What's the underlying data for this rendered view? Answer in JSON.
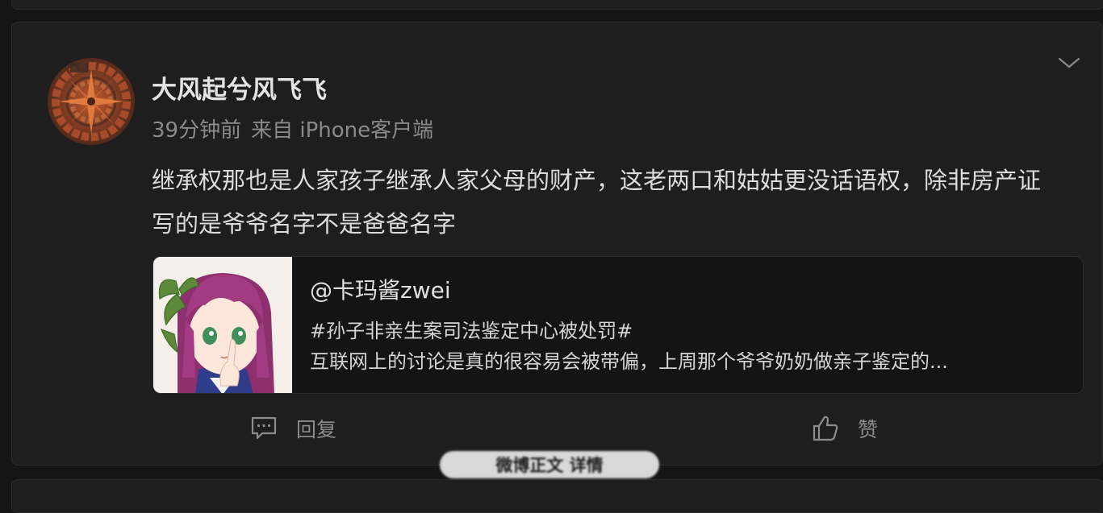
{
  "post": {
    "username": "大风起兮风飞飞",
    "time": "39分钟前",
    "source": "来自 iPhone客户端",
    "content": "继承权那也是人家孩子继承人家父母的财产，这老两口和姑姑更没话语权，除非房产证写的是爷爷名字不是爸爸名字"
  },
  "quote": {
    "author": "@卡玛酱zwei",
    "hashtag": "#孙子非亲生案司法鉴定中心被处罚#",
    "text": "互联网上的讨论是真的很容易会被带偏，上周那个爷爷奶奶做亲子鉴定的..."
  },
  "actions": {
    "reply_label": "回复",
    "like_label": "赞"
  },
  "toast": {
    "text": "微博正文 详情"
  },
  "icons": {
    "more": "chevron-down-icon",
    "reply": "comment-icon",
    "like": "thumbs-up-icon"
  },
  "colors": {
    "background": "#151515",
    "card": "#1e1e1e",
    "quote_bg": "#141414",
    "text_primary": "#e4e4e4",
    "text_secondary": "#8a8a8a"
  }
}
